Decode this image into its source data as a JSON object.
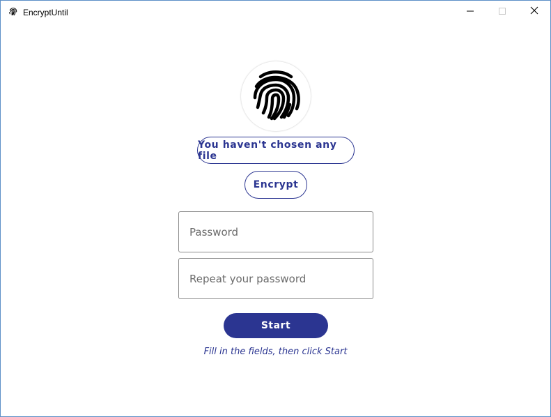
{
  "window": {
    "title": "EncryptUntil",
    "icon": "fingerprint-icon",
    "controls": [
      "minimize-icon",
      "maximize-icon",
      "close-icon"
    ]
  },
  "main": {
    "logo_icon": "fingerprint-icon",
    "file_button_label": "You haven't chosen any file",
    "mode_button_label": "Encrypt",
    "password_placeholder": "Password",
    "password_value": "",
    "repeat_placeholder": "Repeat your password",
    "repeat_value": "",
    "start_button_label": "Start",
    "hint_text": "Fill in the fields, then click Start"
  },
  "colors": {
    "accent": "#2b3591",
    "window_border": "#5b8fc7",
    "field_border": "#8a8a8a"
  }
}
